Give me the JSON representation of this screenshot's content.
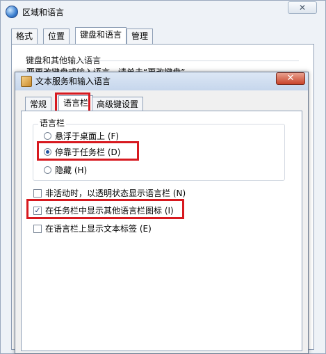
{
  "outer_window": {
    "title": "区域和语言",
    "tabs": [
      {
        "label": "格式"
      },
      {
        "label": "位置"
      },
      {
        "label": "键盘和语言"
      },
      {
        "label": "管理"
      }
    ],
    "keyboard_group_label": "键盘和其他输入语言",
    "keyboard_hint": "要更改键盘或输入语言，请单击“更改键盘”。",
    "close_glyph": "✕"
  },
  "dialog": {
    "title": "文本服务和输入语言",
    "close_glyph": "✕",
    "tabs": [
      {
        "label": "常规"
      },
      {
        "label": "语言栏"
      },
      {
        "label": "高级键设置"
      }
    ],
    "language_bar_group": "语言栏",
    "radio_options": [
      {
        "label": "悬浮于桌面上 (F)",
        "selected": false
      },
      {
        "label": "停靠于任务栏 (D)",
        "selected": true
      },
      {
        "label": "隐藏 (H)",
        "selected": false
      }
    ],
    "checkboxes": [
      {
        "label": "非活动时，以透明状态显示语言栏 (N)",
        "checked": false
      },
      {
        "label": "在任务栏中显示其他语言栏图标 (I)",
        "checked": true
      },
      {
        "label": "在语言栏上显示文本标签 (E)",
        "checked": false
      }
    ],
    "check_glyph": "✓"
  },
  "colors": {
    "highlight": "#d7191f",
    "titlebar": "#c6d6ec"
  }
}
